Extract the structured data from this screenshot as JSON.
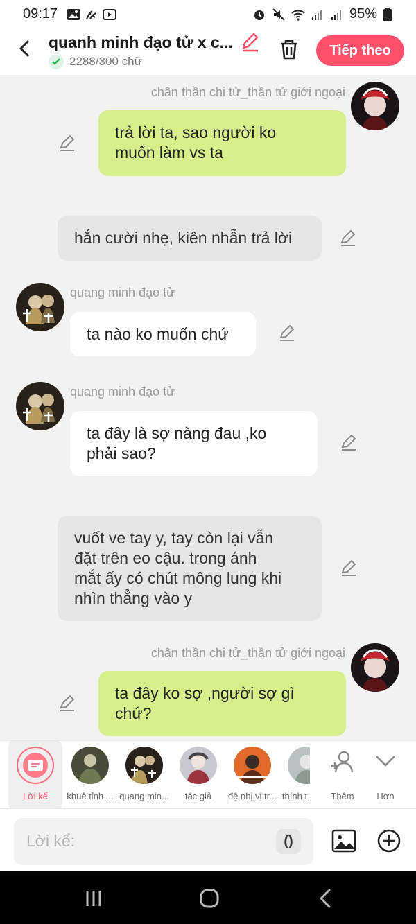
{
  "status": {
    "time": "09:17",
    "battery": "95%"
  },
  "header": {
    "title": "quanh minh đạo tử x c...",
    "word_count": "2288/300 chữ",
    "next_label": "Tiếp theo"
  },
  "messages": [
    {
      "type": "user",
      "name": "chân thần chi tử_thần tử giới ngoại",
      "text": "trả lời ta, sao người ko\nmuốn làm vs ta"
    },
    {
      "type": "narration",
      "text": "hắn cười nhẹ, kiên nhẫn trả lời"
    },
    {
      "type": "character",
      "name": "quang minh đạo tử",
      "text": "ta nào ko muốn chứ"
    },
    {
      "type": "character",
      "name": "quang minh đạo tử",
      "text": "ta đây là sợ nàng đau ,ko\nphải sao?"
    },
    {
      "type": "narration",
      "text": "vuốt ve tay y, tay còn lại vẫn\nđặt trên eo cậu. trong ánh\nmắt ấy có chút mông lung khi\nnhìn thẳng vào y"
    },
    {
      "type": "user",
      "name": "chân thần chi tử_thần tử giới ngoại",
      "text": "ta đây ko sợ ,người sợ gì\nchứ?"
    }
  ],
  "toolbar": {
    "items": [
      {
        "label": "Lời kể"
      },
      {
        "label": "khuê tỉnh ..."
      },
      {
        "label": "quang min..."
      },
      {
        "label": "tác giả"
      },
      {
        "label": "đệ nhị vị tr..."
      },
      {
        "label": "thính t"
      }
    ],
    "more_label": "Thêm",
    "less_label": "Hơn"
  },
  "input": {
    "placeholder": "Lời kể:",
    "paren": "()"
  },
  "colors": {
    "accent": "#ff4f6a",
    "user_bubble": "#d5f08b",
    "narration_bubble": "#e6e6e6"
  }
}
